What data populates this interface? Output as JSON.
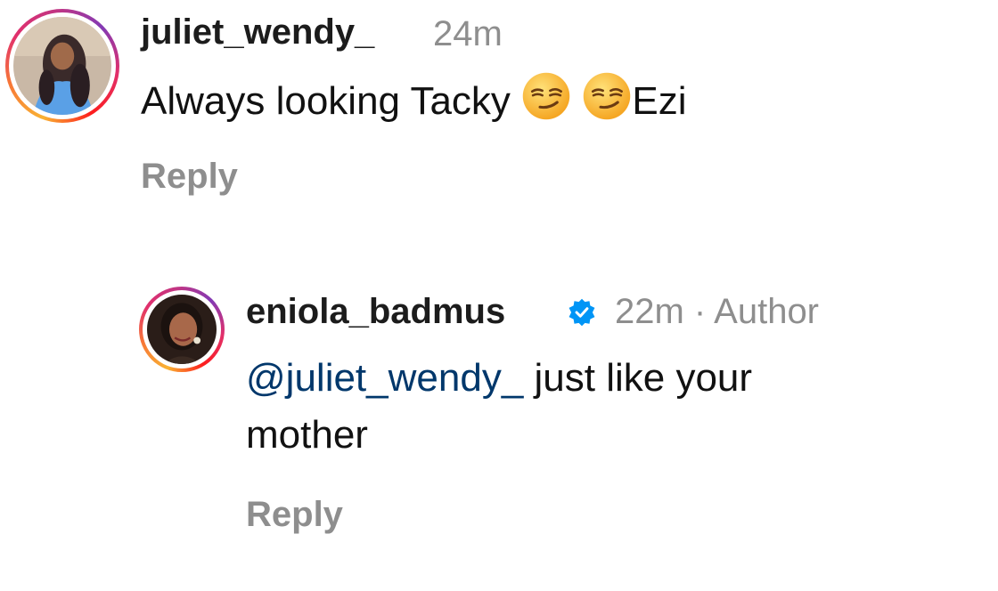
{
  "comments": [
    {
      "username": "juliet_wendy_",
      "meta": "24m",
      "text_before_emoji": "Always looking Tacky ",
      "emoji": "smirking-face",
      "text_after_emoji": "Ezi",
      "reply_label": "Reply"
    },
    {
      "username": "eniola_badmus",
      "verified": true,
      "meta": "22m · Author",
      "mention": "@juliet_wendy_",
      "text_line1": " just like your",
      "text_line2": "mother",
      "reply_label": "Reply"
    }
  ],
  "colors": {
    "mention": "#00376b",
    "muted": "#8e8e8e",
    "verified": "#0095f6"
  }
}
